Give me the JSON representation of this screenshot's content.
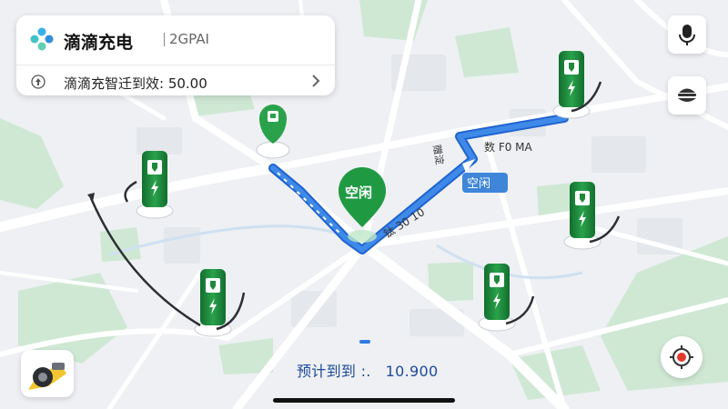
{
  "app": {
    "name": "滴滴充电",
    "subtitle": "2GPAI",
    "promo_text": "滴滴充智迁到效: 50.00"
  },
  "map": {
    "poi_label": "空闲",
    "route_tag": "空闲",
    "route_labels": {
      "top": "数 F0 MA",
      "vertical": "赠淀",
      "diagonal": "钛 30 10"
    }
  },
  "footer": {
    "eta_label": "预计到到 :.",
    "eta_value": "10.900"
  },
  "icons": {
    "voice": "microphone-icon",
    "layers": "layers-icon",
    "locate": "locate-icon",
    "car": "car-icon",
    "promo": "upload-icon"
  },
  "colors": {
    "route": "#2f7be0",
    "charger_green": "#1d8a3a",
    "map_bg": "#eef0f3",
    "road": "#ffffff",
    "park": "#cfe8d4",
    "locate_red": "#e03a2f"
  }
}
